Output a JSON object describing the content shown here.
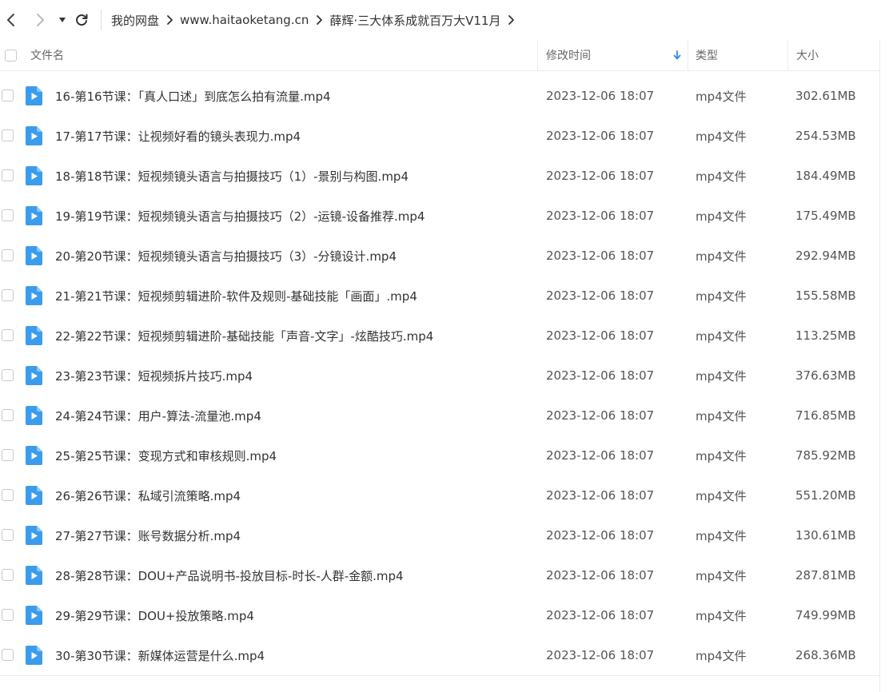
{
  "nav": {
    "back_icon": "chevron-left-icon",
    "forward_icon": "chevron-right-icon",
    "dropdown_icon": "caret-down-icon",
    "refresh_icon": "refresh-icon"
  },
  "breadcrumb": [
    "我的网盘",
    "www.haitaoketang.cn",
    "薛辉·三大体系成就百万大V11月"
  ],
  "columns": {
    "name": "文件名",
    "modified": "修改时间",
    "type": "类型",
    "size": "大小"
  },
  "sort": {
    "column": "modified",
    "direction": "descending",
    "icon": "arrow-down-icon",
    "color": "#2f8cf0"
  },
  "accent_color": "#3b9ced",
  "files": [
    {
      "name": "16-第16节课：「真人口述」到底怎么拍有流量.mp4",
      "modified": "2023-12-06 18:07",
      "type": "mp4文件",
      "size": "302.61MB"
    },
    {
      "name": "17-第17节课：让视频好看的镜头表现力.mp4",
      "modified": "2023-12-06 18:07",
      "type": "mp4文件",
      "size": "254.53MB"
    },
    {
      "name": "18-第18节课：短视频镜头语言与拍摄技巧（1）-景别与构图.mp4",
      "modified": "2023-12-06 18:07",
      "type": "mp4文件",
      "size": "184.49MB"
    },
    {
      "name": "19-第19节课：短视频镜头语言与拍摄技巧（2）-运镜-设备推荐.mp4",
      "modified": "2023-12-06 18:07",
      "type": "mp4文件",
      "size": "175.49MB"
    },
    {
      "name": "20-第20节课：短视频镜头语言与拍摄技巧（3）-分镜设计.mp4",
      "modified": "2023-12-06 18:07",
      "type": "mp4文件",
      "size": "292.94MB"
    },
    {
      "name": "21-第21节课：短视频剪辑进阶-软件及规则-基础技能「画面」.mp4",
      "modified": "2023-12-06 18:07",
      "type": "mp4文件",
      "size": "155.58MB"
    },
    {
      "name": "22-第22节课：短视频剪辑进阶-基础技能「声音-文字」-炫酷技巧.mp4",
      "modified": "2023-12-06 18:07",
      "type": "mp4文件",
      "size": "113.25MB"
    },
    {
      "name": "23-第23节课：短视频拆片技巧.mp4",
      "modified": "2023-12-06 18:07",
      "type": "mp4文件",
      "size": "376.63MB"
    },
    {
      "name": "24-第24节课：用户-算法-流量池.mp4",
      "modified": "2023-12-06 18:07",
      "type": "mp4文件",
      "size": "716.85MB"
    },
    {
      "name": "25-第25节课：变现方式和审核规则.mp4",
      "modified": "2023-12-06 18:07",
      "type": "mp4文件",
      "size": "785.92MB"
    },
    {
      "name": "26-第26节课：私域引流策略.mp4",
      "modified": "2023-12-06 18:07",
      "type": "mp4文件",
      "size": "551.20MB"
    },
    {
      "name": "27-第27节课：账号数据分析.mp4",
      "modified": "2023-12-06 18:07",
      "type": "mp4文件",
      "size": "130.61MB"
    },
    {
      "name": "28-第28节课：DOU+产品说明书-投放目标-时长-人群-金额.mp4",
      "modified": "2023-12-06 18:07",
      "type": "mp4文件",
      "size": "287.81MB"
    },
    {
      "name": "29-第29节课：DOU+投放策略.mp4",
      "modified": "2023-12-06 18:07",
      "type": "mp4文件",
      "size": "749.99MB"
    },
    {
      "name": "30-第30节课：新媒体运营是什么.mp4",
      "modified": "2023-12-06 18:07",
      "type": "mp4文件",
      "size": "268.36MB"
    }
  ]
}
